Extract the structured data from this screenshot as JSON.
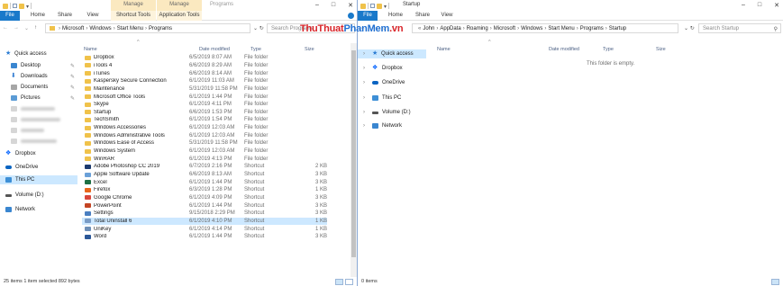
{
  "left": {
    "title_ctx": [
      "Manage",
      "Manage"
    ],
    "app_title": "Programs",
    "tabs": [
      "File",
      "Home",
      "Share",
      "View",
      "Shortcut Tools",
      "Application Tools"
    ],
    "path": [
      "Microsoft",
      "Windows",
      "Start Menu",
      "Programs"
    ],
    "search_placeholder": "Search Programs",
    "columns": [
      "Name",
      "Date modified",
      "Type",
      "Size"
    ],
    "nav": [
      {
        "label": "Quick access",
        "color": "#2b7cd3"
      },
      {
        "label": "Desktop",
        "color": "#3a86d0"
      },
      {
        "label": "Downloads",
        "color": "#2e7ad1"
      },
      {
        "label": "Documents",
        "color": "#a6a6a6"
      },
      {
        "label": "Pictures",
        "color": "#5b9bd5"
      },
      {
        "label": "Dropbox",
        "color": "#0061ff"
      },
      {
        "label": "OneDrive",
        "color": "#0a64c2"
      },
      {
        "label": "This PC",
        "color": "#3d8fd6"
      },
      {
        "label": "Volume (D:)",
        "color": "#555555"
      },
      {
        "label": "Network",
        "color": "#3a86d0"
      }
    ],
    "rows": [
      {
        "name": "Dropbox",
        "date": "6/5/2019 8:07 AM",
        "type": "File folder",
        "size": "",
        "color": "#f0c24a"
      },
      {
        "name": "iTools 4",
        "date": "6/6/2019 8:29 AM",
        "type": "File folder",
        "size": "",
        "color": "#f0c24a"
      },
      {
        "name": "iTunes",
        "date": "6/6/2019 8:14 AM",
        "type": "File folder",
        "size": "",
        "color": "#f0c24a"
      },
      {
        "name": "Kaspersky Secure Connection",
        "date": "6/1/2019 11:03 AM",
        "type": "File folder",
        "size": "",
        "color": "#f0c24a"
      },
      {
        "name": "Maintenance",
        "date": "5/31/2019 11:58 PM",
        "type": "File folder",
        "size": "",
        "color": "#f0c24a"
      },
      {
        "name": "Microsoft Office Tools",
        "date": "6/1/2019 1:44 PM",
        "type": "File folder",
        "size": "",
        "color": "#f0c24a"
      },
      {
        "name": "Skype",
        "date": "6/1/2019 4:11 PM",
        "type": "File folder",
        "size": "",
        "color": "#f0c24a"
      },
      {
        "name": "Startup",
        "date": "6/6/2019 1:53 PM",
        "type": "File folder",
        "size": "",
        "color": "#f0c24a"
      },
      {
        "name": "TechSmith",
        "date": "6/1/2019 1:54 PM",
        "type": "File folder",
        "size": "",
        "color": "#f0c24a"
      },
      {
        "name": "Windows Accessories",
        "date": "6/1/2019 12:03 AM",
        "type": "File folder",
        "size": "",
        "color": "#f0c24a"
      },
      {
        "name": "Windows Administrative Tools",
        "date": "6/1/2019 12:03 AM",
        "type": "File folder",
        "size": "",
        "color": "#f0c24a"
      },
      {
        "name": "Windows Ease of Access",
        "date": "5/31/2019 11:58 PM",
        "type": "File folder",
        "size": "",
        "color": "#f0c24a"
      },
      {
        "name": "Windows System",
        "date": "6/1/2019 12:03 AM",
        "type": "File folder",
        "size": "",
        "color": "#f0c24a"
      },
      {
        "name": "WinRAR",
        "date": "6/1/2019 4:13 PM",
        "type": "File folder",
        "size": "",
        "color": "#f0c24a"
      },
      {
        "name": "Adobe Photoshop CC 2019",
        "date": "6/7/2019 2:16 PM",
        "type": "Shortcut",
        "size": "2 KB",
        "color": "#1c3a6e"
      },
      {
        "name": "Apple Software Update",
        "date": "6/6/2019 8:13 AM",
        "type": "Shortcut",
        "size": "3 KB",
        "color": "#6aa0d8"
      },
      {
        "name": "Excel",
        "date": "6/1/2019 1:44 PM",
        "type": "Shortcut",
        "size": "3 KB",
        "color": "#1d7044"
      },
      {
        "name": "Firefox",
        "date": "6/3/2019 1:28 PM",
        "type": "Shortcut",
        "size": "1 KB",
        "color": "#e8661c"
      },
      {
        "name": "Google Chrome",
        "date": "6/1/2019 4:09 PM",
        "type": "Shortcut",
        "size": "3 KB",
        "color": "#d9463b"
      },
      {
        "name": "PowerPoint",
        "date": "6/1/2019 1:44 PM",
        "type": "Shortcut",
        "size": "3 KB",
        "color": "#c44523"
      },
      {
        "name": "Settings",
        "date": "9/15/2018 2:29 PM",
        "type": "Shortcut",
        "size": "3 KB",
        "color": "#4a7fc1"
      },
      {
        "name": "Total Uninstall 6",
        "date": "6/1/2019 4:10 PM",
        "type": "Shortcut",
        "size": "1 KB",
        "color": "#7a9cc6",
        "selected": true
      },
      {
        "name": "UniKey",
        "date": "6/1/2019 4:14 PM",
        "type": "Shortcut",
        "size": "1 KB",
        "color": "#6d8fb8"
      },
      {
        "name": "Word",
        "date": "6/1/2019 1:44 PM",
        "type": "Shortcut",
        "size": "3 KB",
        "color": "#2b5797"
      }
    ],
    "status": "25 items    1 item selected  892 bytes"
  },
  "right": {
    "app_title": "Startup",
    "tabs": [
      "File",
      "Home",
      "Share",
      "View"
    ],
    "path": [
      "John",
      "AppData",
      "Roaming",
      "Microsoft",
      "Windows",
      "Start Menu",
      "Programs",
      "Startup"
    ],
    "search_placeholder": "Search Startup",
    "columns": [
      "Name",
      "Date modified",
      "Type",
      "Size"
    ],
    "empty_message": "This folder is empty.",
    "nav": [
      {
        "label": "Quick access",
        "color": "#2b7cd3"
      },
      {
        "label": "Dropbox",
        "color": "#0061ff"
      },
      {
        "label": "OneDrive",
        "color": "#0a64c2"
      },
      {
        "label": "This PC",
        "color": "#3d8fd6"
      },
      {
        "label": "Volume (D:)",
        "color": "#555555"
      },
      {
        "label": "Network",
        "color": "#3a86d0"
      }
    ],
    "status": "0 items"
  },
  "watermark": {
    "part1": "ThuThuat",
    "part2": "PhanMem",
    "part3": ".vn"
  }
}
